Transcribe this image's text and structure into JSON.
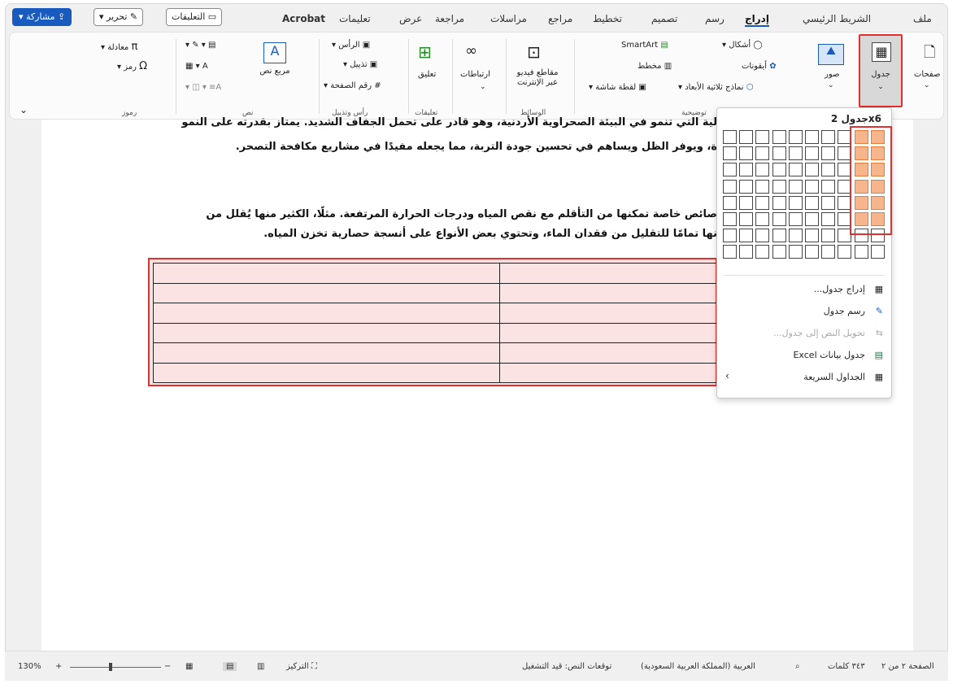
{
  "tabs": {
    "file": "ملف",
    "home": "الشريط الرئيسي",
    "insert": "إدراج",
    "draw": "رسم",
    "design": "تصميم",
    "layout": "تخطيط",
    "references": "مراجع",
    "mailings": "مراسلات",
    "review": "مراجعة",
    "view": "عرض",
    "help": "تعليمات",
    "acrobat": "Acrobat",
    "comments_btn": "التعليقات",
    "editing_btn": "تحرير",
    "share_btn": "مشاركة"
  },
  "ribbon": {
    "pages": "صفحات",
    "table": "جدول",
    "pictures": "صور",
    "shapes": "أشكال",
    "icons": "أيقونات",
    "models3d": "نماذج ثلاثية الأبعاد",
    "smartart": "SmartArt",
    "chart": "مخطط",
    "screenshot": "لقطة شاشة",
    "illustrations_group": "توضيحية",
    "online_video": "مقاطع فيديو عبر الإنترنت",
    "media_group": "الوسائط",
    "links": "ارتباطات",
    "comment": "تعليق",
    "comments_group": "تعليقات",
    "header": "الرأس",
    "footer": "تذييل",
    "page_number": "رقم الصفحة",
    "header_footer_group": "رأس وتذييل",
    "textbox": "مربع نص",
    "text_group": "نص",
    "equation": "معادلة",
    "symbol": "رمز",
    "symbols_group": "رموز"
  },
  "document": {
    "para1_line1": "لية التي تنمو في البيئة الصحراوية الأردنية، وهو قادر على تحمل الجفاف الشديد. يمتاز بقدرته على النمو",
    "para1_line2": "ة، ويوفر الظل ويساهم في تحسين جودة التربة، مما يجعله مفيدًا في مشاريع مكافحة التصحر.",
    "para2_line1": "صائص خاصة تمكنها من التأقلم مع نقص المياه ودرجات الحرارة المرتفعة. مثلًا، الكثير منها يُقلل من",
    "para2_line2": "نها تمامًا للتقليل من فقدان الماء، وتحتوي بعض الأنواع على أنسجة حصارية تخزن المياه.",
    "table_rows": 6,
    "table_cols": 2
  },
  "dropdown": {
    "title": "جدول 2x6",
    "grid_cols": 10,
    "grid_rows": 8,
    "selected_cols": 2,
    "selected_rows": 6,
    "insert_table": "إدراج جدول...",
    "draw_table": "رسم جدول",
    "convert_text": "تحويل النص إلى جدول...",
    "excel_table": "جدول بيانات Excel",
    "quick_tables": "الجداول السريعة"
  },
  "status": {
    "page": "الصفحة ٢ من ٢",
    "words": "٣٤٣ كلمات",
    "language": "العربية (المملكة العربية السعودية)",
    "predictions": "توقعات النص: قيد التشغيل",
    "focus": "التركيز",
    "zoom": "130%"
  },
  "colors": {
    "accent": "#185abd",
    "highlight_red": "#e03030",
    "grid_selected": "#f7b58c",
    "table_fill": "#fbe3e3"
  }
}
